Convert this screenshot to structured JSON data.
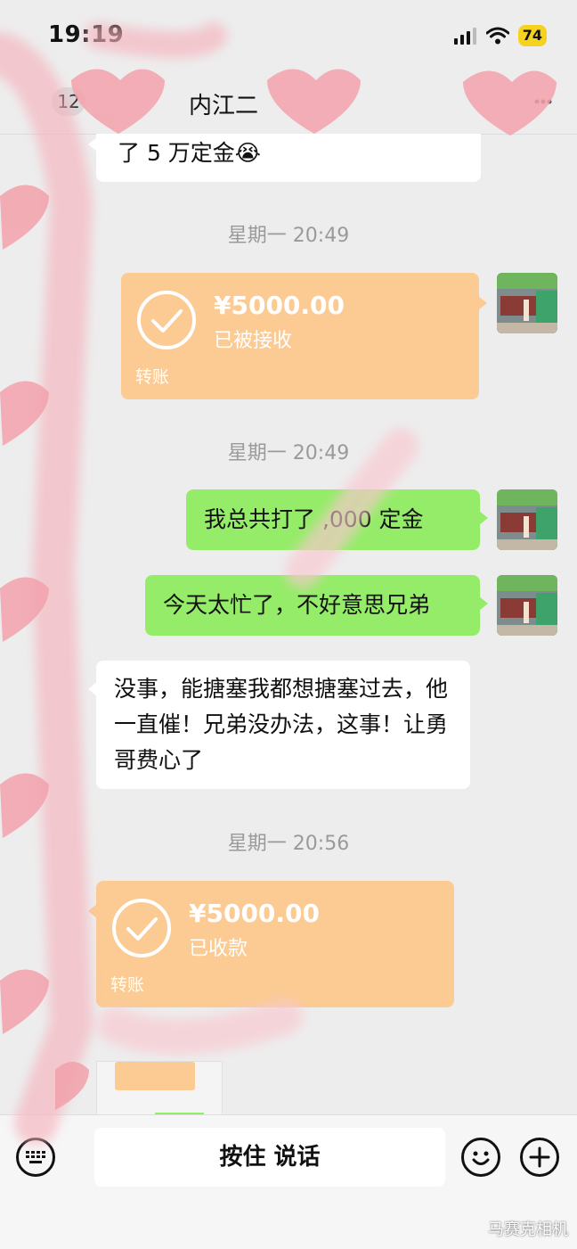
{
  "status_bar": {
    "time": "19:19",
    "battery": "74"
  },
  "nav": {
    "back_count": "12",
    "title": "内江二"
  },
  "messages": {
    "partial_top": {
      "text": "了 5 万定金😭"
    },
    "ts1": "星期一 20:49",
    "transfer1": {
      "amount": "¥5000.00",
      "status": "已被接收",
      "label": "转账"
    },
    "ts2": "星期一 20:49",
    "out1": "我总共打了  ,000 定金",
    "out2": "今天太忙了，不好意思兄弟",
    "in1": "没事，能搪塞我都想搪塞过去，他一直催！兄弟没办法，这事！让勇哥费心了",
    "ts3": "星期一 20:56",
    "transfer2": {
      "amount": "¥5000.00",
      "status": "已收款",
      "label": "转账"
    }
  },
  "input_bar": {
    "hold_to_talk": "按住 说话"
  },
  "watermark": "马赛克相机",
  "colors": {
    "out_bubble": "#95ec69",
    "in_bubble": "#ffffff",
    "transfer_bubble": "#fbcb93",
    "background": "#ededed",
    "timestamp": "#9a9a9a"
  },
  "icons": [
    "keyboard-icon",
    "emoji-icon",
    "plus-icon",
    "wifi-icon",
    "signal-icon",
    "battery-icon",
    "check-circle-icon"
  ]
}
